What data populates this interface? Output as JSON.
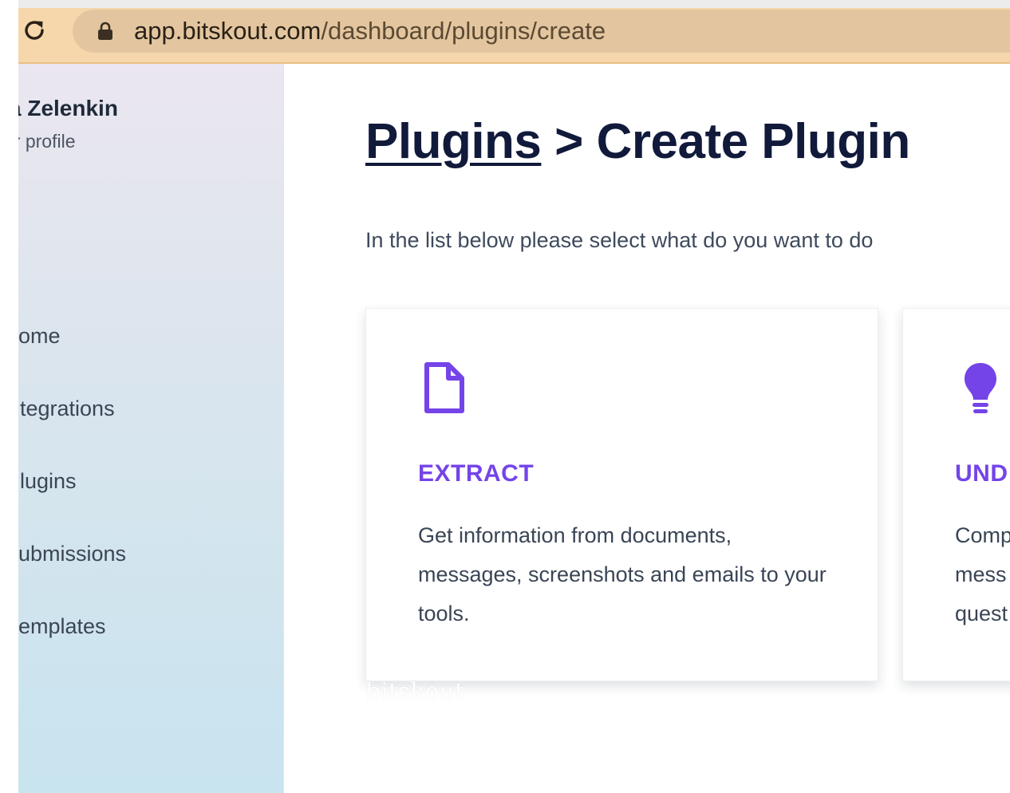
{
  "browser": {
    "url_host": "app.bitskout.com",
    "url_path": "/dashboard/plugins/create",
    "reload_icon": "reload-icon",
    "lock_icon": "lock-icon",
    "bar_color": "#f6d7ab"
  },
  "sidebar": {
    "user_name": "a Zelenkin",
    "profile_link": "ur profile",
    "items": [
      {
        "label": "ome"
      },
      {
        "label": "tegrations"
      },
      {
        "label": "lugins"
      },
      {
        "label": "ubmissions"
      },
      {
        "label": "emplates"
      }
    ]
  },
  "main": {
    "breadcrumb_link": "Plugins",
    "breadcrumb_sep": " > ",
    "title": "Create Plugin",
    "subtitle": "In the list below please select what do you want to do",
    "cards": [
      {
        "icon": "document-icon",
        "title": "EXTRACT",
        "description": "Get information from documents, messages, screenshots and emails to your tools."
      },
      {
        "icon": "lightbulb-icon",
        "title": "UND",
        "description": "Comp\nmess\nquest"
      }
    ],
    "accent_color": "#7444e8",
    "watermark": "bitskout"
  }
}
